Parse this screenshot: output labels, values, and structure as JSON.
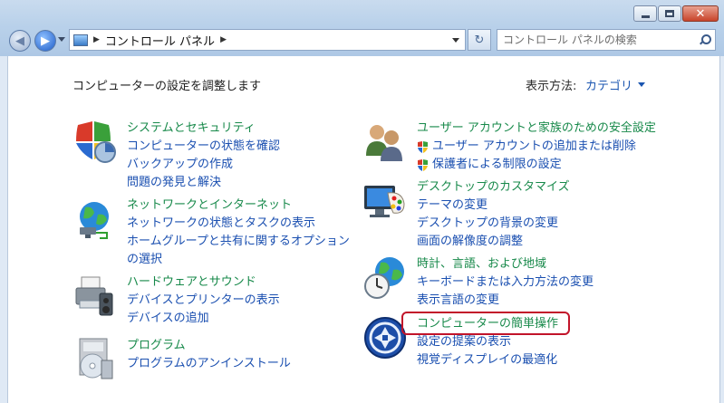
{
  "window": {
    "minimize_icon": "minimize-icon",
    "maximize_icon": "maximize-icon",
    "close_icon": "close-icon"
  },
  "nav": {
    "back_icon": "back-arrow-icon",
    "forward_icon": "forward-arrow-icon",
    "address_crumb": "コントロール パネル",
    "refresh_icon": "refresh-icon"
  },
  "search": {
    "placeholder": "コントロール パネルの検索"
  },
  "page": {
    "title": "コンピューターの設定を調整します",
    "view_label": "表示方法:",
    "view_value": "カテゴリ"
  },
  "categories": [
    {
      "title": "システムとセキュリティ",
      "icon": "shield-security-icon",
      "links": [
        "コンピューターの状態を確認",
        "バックアップの作成",
        "問題の発見と解決"
      ]
    },
    {
      "title": "ネットワークとインターネット",
      "icon": "network-globe-icon",
      "links": [
        "ネットワークの状態とタスクの表示",
        "ホームグループと共有に関するオプションの選択"
      ]
    },
    {
      "title": "ハードウェアとサウンド",
      "icon": "printer-hardware-icon",
      "links": [
        "デバイスとプリンターの表示",
        "デバイスの追加"
      ]
    },
    {
      "title": "プログラム",
      "icon": "programs-disc-icon",
      "links": [
        "プログラムのアンインストール"
      ]
    },
    {
      "title": "ユーザー アカウントと家族のための安全設定",
      "icon": "users-icon",
      "links": [
        "ユーザー アカウントの追加または削除",
        "保護者による制限の設定"
      ]
    },
    {
      "title": "デスクトップのカスタマイズ",
      "icon": "monitor-palette-icon",
      "links": [
        "テーマの変更",
        "デスクトップの背景の変更",
        "画面の解像度の調整"
      ]
    },
    {
      "title": "時計、言語、および地域",
      "icon": "clock-globe-icon",
      "links": [
        "キーボードまたは入力方法の変更",
        "表示言語の変更"
      ]
    },
    {
      "title": "コンピューターの簡単操作",
      "icon": "ease-of-access-icon",
      "links": [
        "設定の提案の表示",
        "視覚ディスプレイの最適化"
      ]
    }
  ],
  "colors": {
    "category_title": "#17894a",
    "link": "#1a4fb0",
    "highlight_border": "#c2142a"
  }
}
